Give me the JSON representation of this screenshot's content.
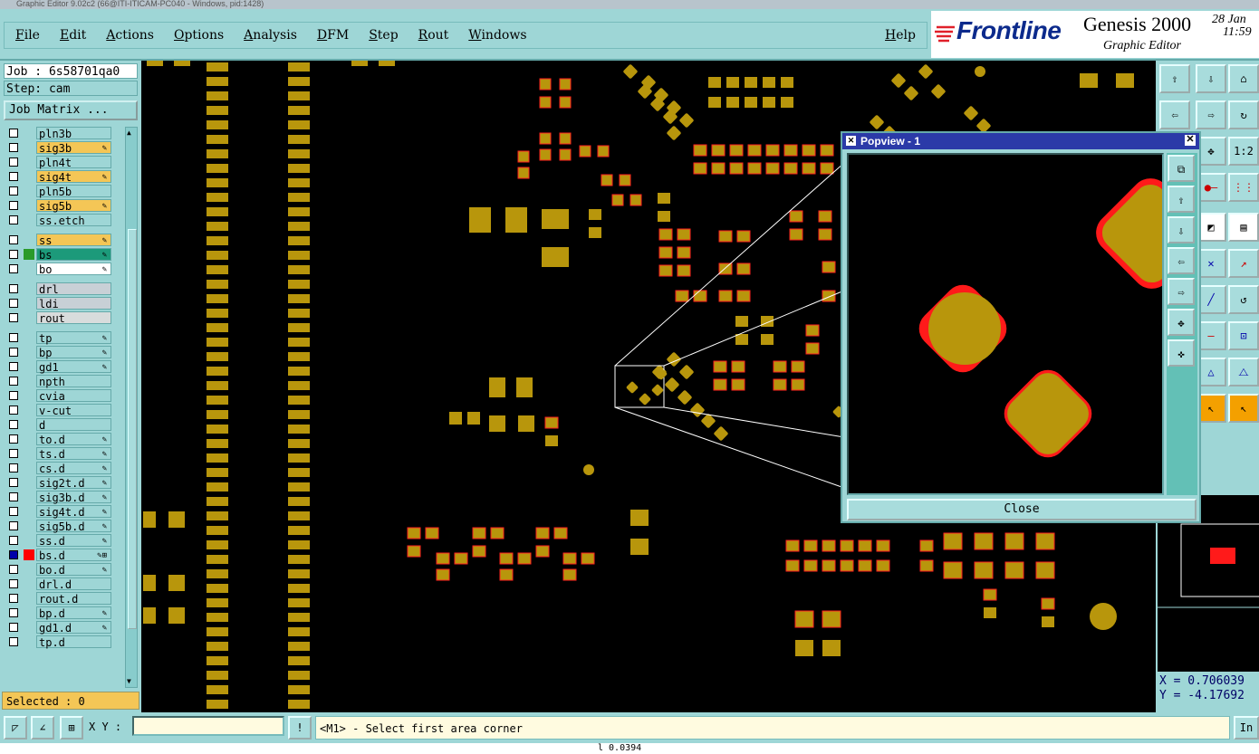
{
  "window": {
    "title": "Graphic Editor 9.02c2 (66@ITI-ITICAM-PC040 - Windows, pid:1428)"
  },
  "menu": {
    "items": [
      "File",
      "Edit",
      "Actions",
      "Options",
      "Analysis",
      "DFM",
      "Step",
      "Rout",
      "Windows"
    ],
    "help": "Help"
  },
  "brand": {
    "logo": "Frontline",
    "product": "Genesis 2000",
    "subtitle": "Graphic Editor",
    "date_line1": "28 Jan",
    "date_line2": "11:59"
  },
  "job": {
    "job_line": "Job : 6s58701qa0",
    "step_line": "Step: cam",
    "matrix_button": "Job Matrix ..."
  },
  "layers": [
    {
      "name": "pln3b",
      "color": "#9ed6d6",
      "mark": ""
    },
    {
      "name": "sig3b",
      "color": "#f4c656",
      "mark": "✎"
    },
    {
      "name": "pln4t",
      "color": "#9ed6d6",
      "mark": ""
    },
    {
      "name": "sig4t",
      "color": "#f4c656",
      "mark": "✎"
    },
    {
      "name": "pln5b",
      "color": "#9ed6d6",
      "mark": ""
    },
    {
      "name": "sig5b",
      "color": "#f4c656",
      "mark": "✎"
    },
    {
      "name": "ss.etch",
      "color": "#9ed6d6",
      "mark": ""
    },
    {
      "name": "ss",
      "color": "#f4c656",
      "mark": "✎"
    },
    {
      "name": "bs",
      "color": "#1c9a7a",
      "mark": "✎"
    },
    {
      "name": "bo",
      "color": "#ffffff",
      "mark": "✎"
    },
    {
      "name": "drl",
      "color": "#c8d0d6",
      "mark": ""
    },
    {
      "name": "ldi",
      "color": "#c8d0d6",
      "mark": ""
    },
    {
      "name": "rout",
      "color": "#d8dcdc",
      "mark": ""
    },
    {
      "name": "tp",
      "color": "#9ed6d6",
      "mark": "✎"
    },
    {
      "name": "bp",
      "color": "#9ed6d6",
      "mark": "✎"
    },
    {
      "name": "gd1",
      "color": "#9ed6d6",
      "mark": "✎"
    },
    {
      "name": "npth",
      "color": "#9ed6d6",
      "mark": ""
    },
    {
      "name": "cvia",
      "color": "#9ed6d6",
      "mark": ""
    },
    {
      "name": "v-cut",
      "color": "#9ed6d6",
      "mark": ""
    },
    {
      "name": "d",
      "color": "#9ed6d6",
      "mark": ""
    },
    {
      "name": "to.d",
      "color": "#9ed6d6",
      "mark": "✎"
    },
    {
      "name": "ts.d",
      "color": "#9ed6d6",
      "mark": "✎"
    },
    {
      "name": "cs.d",
      "color": "#9ed6d6",
      "mark": "✎"
    },
    {
      "name": "sig2t.d",
      "color": "#9ed6d6",
      "mark": "✎"
    },
    {
      "name": "sig3b.d",
      "color": "#9ed6d6",
      "mark": "✎"
    },
    {
      "name": "sig4t.d",
      "color": "#9ed6d6",
      "mark": "✎"
    },
    {
      "name": "sig5b.d",
      "color": "#9ed6d6",
      "mark": "✎"
    },
    {
      "name": "ss.d",
      "color": "#9ed6d6",
      "mark": "✎"
    },
    {
      "name": "bs.d",
      "color": "#9ed6d6",
      "mark": "✎⊞"
    },
    {
      "name": "bo.d",
      "color": "#9ed6d6",
      "mark": "✎"
    },
    {
      "name": "drl.d",
      "color": "#9ed6d6",
      "mark": ""
    },
    {
      "name": "rout.d",
      "color": "#9ed6d6",
      "mark": ""
    },
    {
      "name": "bp.d",
      "color": "#9ed6d6",
      "mark": "✎"
    },
    {
      "name": "gd1.d",
      "color": "#9ed6d6",
      "mark": "✎"
    },
    {
      "name": "tp.d",
      "color": "#9ed6d6",
      "mark": ""
    }
  ],
  "selected": "Selected : 0",
  "popview": {
    "title": "Popview - 1",
    "close": "Close"
  },
  "coords": {
    "x": "X = 0.706039",
    "y": "Y = -4.17692"
  },
  "bottom": {
    "xy_label": "X Y :",
    "xy_value": "",
    "prompt": "<M1> - Select first area corner",
    "right_button": "In"
  },
  "status": "l    0.0394",
  "colors": {
    "pad": "#b8960c",
    "pad_outline": "#ff2020",
    "accent": "#9ed6d6"
  }
}
